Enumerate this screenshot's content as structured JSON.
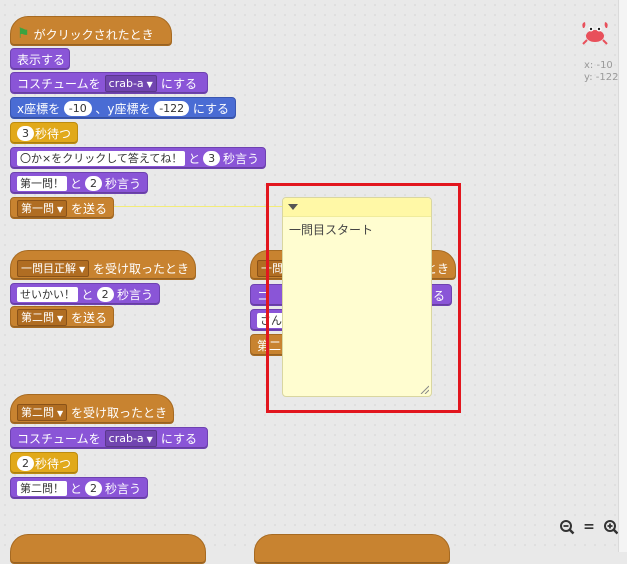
{
  "script1": {
    "hat_label": "がクリックされたとき",
    "show": "表示する",
    "costume_prefix": "コスチュームを",
    "costume_value": "crab-a",
    "costume_suffix": "にする",
    "goto_x_label": "x座標を",
    "goto_x_value": "-10",
    "goto_y_label": "、y座標を",
    "goto_y_value": "-122",
    "goto_suffix": "にする",
    "wait_value": "3",
    "wait_label": "秒待つ",
    "say1_text": "〇か×をクリックして答えてね！",
    "say1_and": "と",
    "say1_secs": "3",
    "say1_label": "秒言う",
    "say2_text": "第一問！",
    "say2_and": "と",
    "say2_secs": "2",
    "say2_label": "秒言う",
    "broadcast_value": "第一問",
    "broadcast_label": "を送る"
  },
  "script2": {
    "hat_value": "一問目正解",
    "hat_label": "を受け取ったとき",
    "say_text": "せいかい！",
    "say_and": "と",
    "say_secs": "2",
    "say_label": "秒言う",
    "broadcast_value": "第二問",
    "broadcast_label": "を送る"
  },
  "script3": {
    "hat_value": "一問",
    "hat_label": "とき",
    "row2_prefix": "コ",
    "row2_suffix": "る",
    "row3_prefix": "さん",
    "row4_prefix": "第二"
  },
  "script4": {
    "hat_value": "第二問",
    "hat_label": "を受け取ったとき",
    "costume_prefix": "コスチュームを",
    "costume_value": "crab-a",
    "costume_suffix": "にする",
    "wait_value": "2",
    "wait_label": "秒待つ",
    "say_text": "第二問！",
    "say_and": "と",
    "say_secs": "2",
    "say_label": "秒言う"
  },
  "comment": {
    "text": "一問目スタート"
  },
  "sprite": {
    "x_label": "x: -10",
    "y_label": "y: -122"
  },
  "zoom": {
    "out": "−",
    "reset": "=",
    "in": "+"
  },
  "colors": {
    "highlight": "#e2161e",
    "looks": "#8a55d7",
    "events": "#c88330",
    "motion": "#4a6cd4",
    "control": "#e1a91a"
  }
}
